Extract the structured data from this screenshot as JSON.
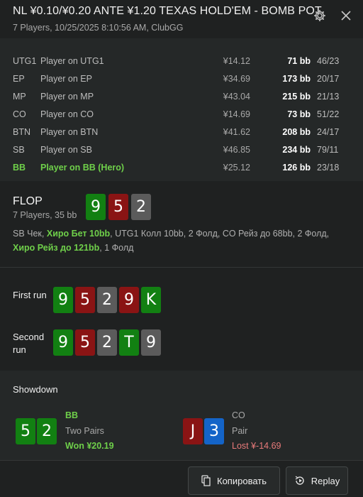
{
  "header": {
    "title": "NL ¥0.10/¥0.20 ANTE ¥1.20 TEXAS HOLD'EM - BOMB POT",
    "subtitle": "7 Players, 10/25/2025 8:10:56 AM, ClubGG",
    "settings_icon": "gear-icon",
    "close_icon": "close-icon"
  },
  "players": [
    {
      "pos": "UTG1",
      "name": "Player on UTG1",
      "amount": "¥14.12",
      "bb": "71 bb",
      "stat": "46/23"
    },
    {
      "pos": "EP",
      "name": "Player on EP",
      "amount": "¥34.69",
      "bb": "173 bb",
      "stat": "20/17"
    },
    {
      "pos": "MP",
      "name": "Player on MP",
      "amount": "¥43.04",
      "bb": "215 bb",
      "stat": "21/13"
    },
    {
      "pos": "CO",
      "name": "Player on CO",
      "amount": "¥14.69",
      "bb": "73 bb",
      "stat": "51/22"
    },
    {
      "pos": "BTN",
      "name": "Player on BTN",
      "amount": "¥41.62",
      "bb": "208 bb",
      "stat": "24/17"
    },
    {
      "pos": "SB",
      "name": "Player on SB",
      "amount": "¥46.85",
      "bb": "234 bb",
      "stat": "79/11"
    },
    {
      "pos": "BB",
      "name": "Player on BB (Hero)",
      "amount": "¥25.12",
      "bb": "126 bb",
      "stat": "23/18"
    }
  ],
  "flop": {
    "title": "FLOP",
    "sub": "7 Players, 35 bb",
    "cards": [
      "9",
      "5",
      "2"
    ],
    "actions": {
      "a1": "SB Чек, ",
      "a2": "Хиро Бет 10bb",
      "a3": ", UTG1 Колл 10bb, 2 Фолд, CO Рейз до 68bb, 2 Фолд, ",
      "a4": "Хиро Рейз до 121bb",
      "a5": ", 1 Фолд"
    }
  },
  "runs": {
    "first_label": "First run",
    "first_cards": [
      "9",
      "5",
      "2",
      "9",
      "K"
    ],
    "second_label": "Second run",
    "second_cards": [
      "9",
      "5",
      "2",
      "T",
      "9"
    ]
  },
  "showdown": {
    "title": "Showdown",
    "hero": {
      "cards": [
        "5",
        "2"
      ],
      "pos": "BB",
      "hand": "Two Pairs",
      "result": "Won ¥20.19"
    },
    "villain": {
      "cards": [
        "J",
        "3"
      ],
      "pos": "CO",
      "hand": "Pair",
      "result": "Lost ¥-14.69"
    }
  },
  "footer": {
    "copy_label": "Копировать",
    "replay_label": "Replay"
  },
  "colors": {
    "hero_green": "#6fd04a",
    "loss_red": "#e87a7a",
    "card_green": "#128012",
    "card_red": "#8a1414",
    "card_gray": "#5b5b5b",
    "card_blue": "#1464c8"
  }
}
